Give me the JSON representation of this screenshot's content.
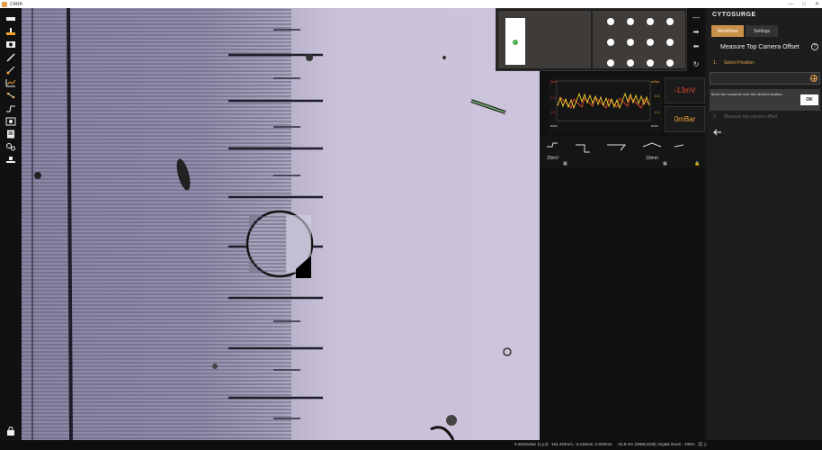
{
  "window": {
    "title": "CARA",
    "min": "—",
    "max": "□",
    "close": "✕"
  },
  "toolbar": {
    "tools": [
      {
        "name": "ruler-icon"
      },
      {
        "name": "stage-icon"
      },
      {
        "name": "camera-icon"
      },
      {
        "name": "pipette-icon"
      },
      {
        "name": "probe-icon"
      },
      {
        "name": "graph-icon"
      },
      {
        "name": "route-icon"
      },
      {
        "name": "waveform-icon"
      },
      {
        "name": "image-icon"
      },
      {
        "name": "document-icon"
      },
      {
        "name": "settings-icon"
      },
      {
        "name": "stack-icon"
      }
    ]
  },
  "readouts": {
    "voltage": "-13mV",
    "pressure": "0mBar",
    "plot_left_top": "2nA",
    "plot_left_mid": "1.0",
    "plot_left_bot": "1.0",
    "plot_right_top": "mBar",
    "plot_right_mid": "0.5",
    "plot_right_bot": "0.1",
    "auto_left": "auto",
    "auto_right": "auto"
  },
  "pulses": {
    "left_value": "20mV",
    "right_value": "10mm"
  },
  "brand": "CYTOSURGE",
  "tabs": {
    "workflows": "Workflows",
    "settings": "Settings"
  },
  "workflow": {
    "title": "Measure Top Camera Offset",
    "step1_num": "1.",
    "step1_title": "Select Position",
    "instruction": "Move the crosshair over the desired location.",
    "ok_label": "OK",
    "step2_num": "2.",
    "step2_title": "Measure top camera offset"
  },
  "status": {
    "pressure": "0.2844mbar",
    "xyz": "[x,y,z] : 104.434mm, -3.118mm, 0.000mm",
    "signal": "-15.8 mV (2588,5236)",
    "zoom": "Digital Zoom : 100%"
  },
  "colors": {
    "accent": "#c9904a",
    "voltage": "#e24a2b",
    "pressure": "#f2a12f"
  }
}
